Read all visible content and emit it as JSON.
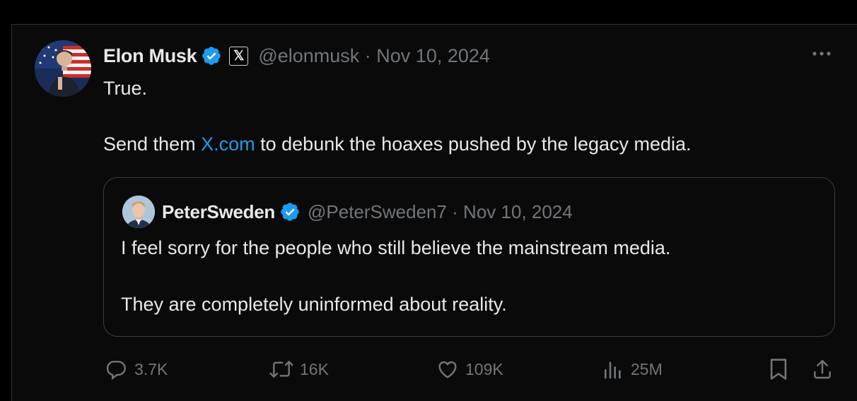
{
  "tweet": {
    "author_name": "Elon Musk",
    "affiliate_badge": "𝕏",
    "handle_line": "@elonmusk · Nov 10, 2024",
    "text_line1": "True.",
    "text_line2_before": "Send them ",
    "text_link": "X.com",
    "text_line2_after": " to debunk the hoaxes pushed by the legacy media."
  },
  "quoted_tweet": {
    "author_name": "PeterSweden",
    "handle_line": "@PeterSweden7 · Nov 10, 2024",
    "text_line1": "I feel sorry for the people who still believe the mainstream media.",
    "text_line2": "They are completely uninformed about reality."
  },
  "actions": {
    "replies": "3.7K",
    "reposts": "16K",
    "likes": "109K",
    "views": "25M"
  },
  "colors": {
    "background": "#000000",
    "text": "#e7e9ea",
    "muted": "#71767b",
    "link": "#1d9bf0",
    "verified": "#1d9bf0",
    "border": "#2f3336"
  },
  "icons": {
    "verified": "verified-badge-icon",
    "more": "more-icon",
    "reply": "reply-icon",
    "repost": "repost-icon",
    "like": "like-icon",
    "views": "views-icon",
    "bookmark": "bookmark-icon",
    "share": "share-icon"
  }
}
